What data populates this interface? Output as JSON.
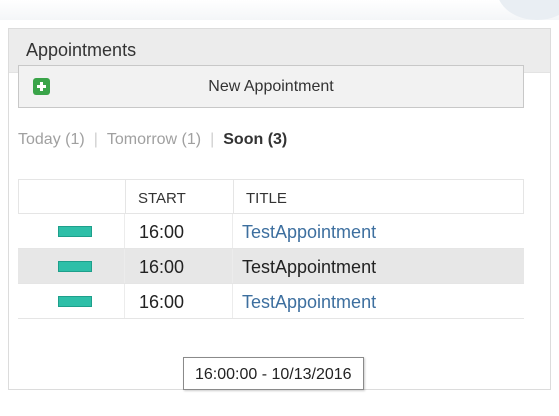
{
  "widget": {
    "title": "Appointments",
    "new_button_label": "New Appointment"
  },
  "filters": [
    {
      "label": "Today (1)",
      "active": false
    },
    {
      "label": "Tomorrow (1)",
      "active": false
    },
    {
      "label": "Soon (3)",
      "active": true
    }
  ],
  "table": {
    "columns": [
      "",
      "START",
      "TITLE"
    ],
    "rows": [
      {
        "color": "#2ebfa8",
        "start": "16:00",
        "title": "TestAppointment"
      },
      {
        "color": "#2ebfa8",
        "start": "16:00",
        "title": "TestAppointment"
      },
      {
        "color": "#2ebfa8",
        "start": "16:00",
        "title": "TestAppointment"
      }
    ]
  },
  "tooltip": {
    "text": "16:00:00 - 10/13/2016"
  }
}
